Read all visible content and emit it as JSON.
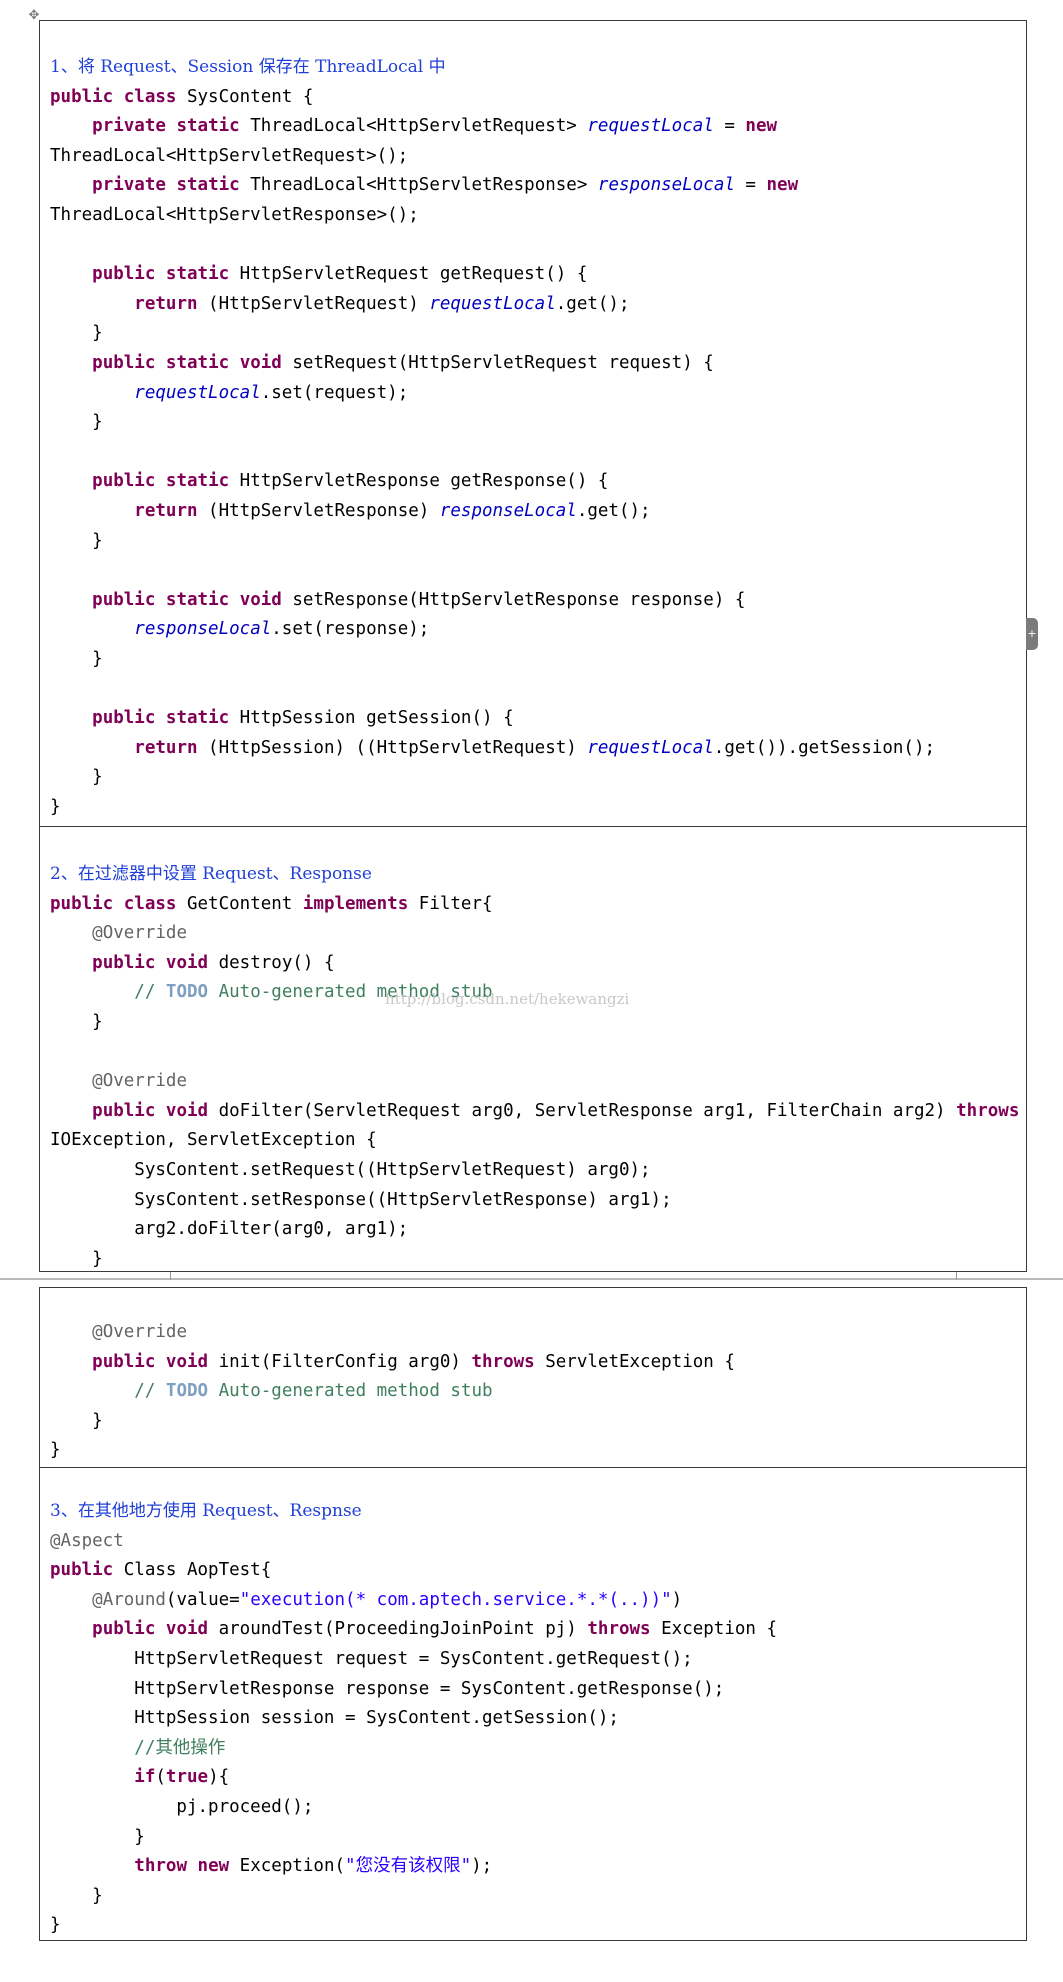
{
  "handle_icon": "move-cross-icon",
  "watermark": "http://blog.csdn.net/hekewangzi",
  "sections": [
    {
      "heading": "1、将 Request、Session 保存在 ThreadLocal 中",
      "lines": [
        "public class SysContent {",
        "    private static ThreadLocal<HttpServletRequest> requestLocal = new",
        "ThreadLocal<HttpServletRequest>();",
        "    private static ThreadLocal<HttpServletResponse> responseLocal = new",
        "ThreadLocal<HttpServletResponse>();",
        "",
        "    public static HttpServletRequest getRequest() {",
        "        return (HttpServletRequest) requestLocal.get();",
        "    }",
        "    public static void setRequest(HttpServletRequest request) {",
        "        requestLocal.set(request);",
        "    }",
        "",
        "    public static HttpServletResponse getResponse() {",
        "        return (HttpServletResponse) responseLocal.get();",
        "    }",
        "",
        "    public static void setResponse(HttpServletResponse response) {",
        "        responseLocal.set(response);",
        "    }",
        "",
        "    public static HttpSession getSession() {",
        "        return (HttpSession) ((HttpServletRequest) requestLocal.get()).getSession();",
        "    }",
        "}"
      ]
    },
    {
      "heading": "2、在过滤器中设置 Request、Response",
      "lines": [
        "public class GetContent implements Filter{",
        "    @Override",
        "    public void destroy() {",
        "        // TODO Auto-generated method stub",
        "    }",
        "",
        "    @Override",
        "    public void doFilter(ServletRequest arg0, ServletResponse arg1, FilterChain arg2) throws",
        "IOException, ServletException {",
        "        SysContent.setRequest((HttpServletRequest) arg0);",
        "        SysContent.setResponse((HttpServletResponse) arg1);",
        "        arg2.doFilter(arg0, arg1);",
        "    }"
      ]
    },
    {
      "heading": "",
      "lines": [
        "    @Override",
        "    public void init(FilterConfig arg0) throws ServletException {",
        "        // TODO Auto-generated method stub",
        "    }",
        "}"
      ]
    },
    {
      "heading": "3、在其他地方使用 Request、Respnse",
      "lines": [
        "@Aspect",
        "public Class AopTest{",
        "    @Around(value=\"execution(* com.aptech.service.*.*(..))\")",
        "    public void aroundTest(ProceedingJoinPoint pj) throws Exception {",
        "        HttpServletRequest request = SysContent.getRequest();",
        "        HttpServletResponse response = SysContent.getResponse();",
        "        HttpSession session = SysContent.getSession();",
        "        //其他操作",
        "        if(true){",
        "            pj.proceed();",
        "        }",
        "        throw new Exception(\"您没有该权限\");",
        "    }",
        "}"
      ]
    }
  ]
}
